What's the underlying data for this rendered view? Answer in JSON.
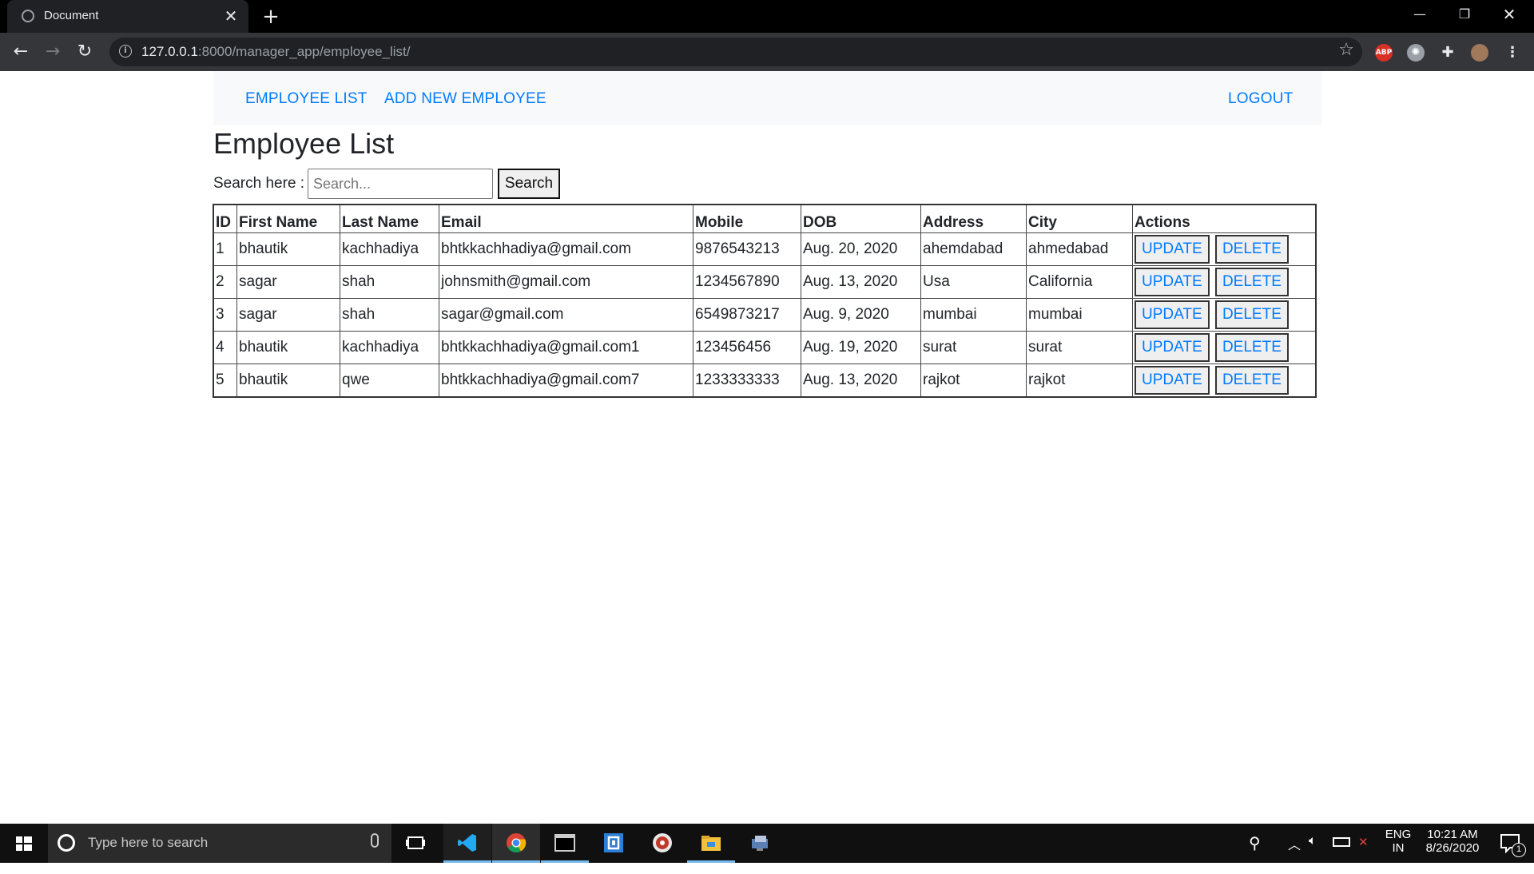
{
  "browser": {
    "tab_title": "Document",
    "url_host": "127.0.0.1",
    "url_path": ":8000/manager_app/employee_list/",
    "ext_abp": "ABP"
  },
  "navbar": {
    "links": [
      "EMPLOYEE LIST",
      "ADD NEW EMPLOYEE"
    ],
    "logout": "LOGOUT"
  },
  "main": {
    "title": "Employee List",
    "search_label": "Search here :",
    "search_placeholder": "Search...",
    "search_button": "Search"
  },
  "table": {
    "headers": [
      "ID",
      "First Name",
      "Last Name",
      "Email",
      "Mobile",
      "DOB",
      "Address",
      "City",
      "Actions"
    ],
    "update_label": "UPDATE",
    "delete_label": "DELETE",
    "rows": [
      [
        "1",
        "bhautik",
        "kachhadiya",
        "bhtkkachhadiya@gmail.com",
        "9876543213",
        "Aug. 20, 2020",
        "ahemdabad",
        "ahmedabad"
      ],
      [
        "2",
        "sagar",
        "shah",
        "johnsmith@gmail.com",
        "1234567890",
        "Aug. 13, 2020",
        "Usa",
        "California"
      ],
      [
        "3",
        "sagar",
        "shah",
        "sagar@gmail.com",
        "6549873217",
        "Aug. 9, 2020",
        "mumbai",
        "mumbai"
      ],
      [
        "4",
        "bhautik",
        "kachhadiya",
        "bhtkkachhadiya@gmail.com1",
        "123456456",
        "Aug. 19, 2020",
        "surat",
        "surat"
      ],
      [
        "5",
        "bhautik",
        "qwe",
        "bhtkkachhadiya@gmail.com7",
        "1233333333",
        "Aug. 13, 2020",
        "rajkot",
        "rajkot"
      ]
    ]
  },
  "taskbar": {
    "search_placeholder": "Type here to search",
    "lang_top": "ENG",
    "lang_bottom": "IN",
    "time": "10:21 AM",
    "date": "8/26/2020",
    "notification_count": "1"
  },
  "colors": {
    "link": "#007bff",
    "navbar_bg": "#f8f9fa",
    "chrome_dark": "#35363a"
  }
}
